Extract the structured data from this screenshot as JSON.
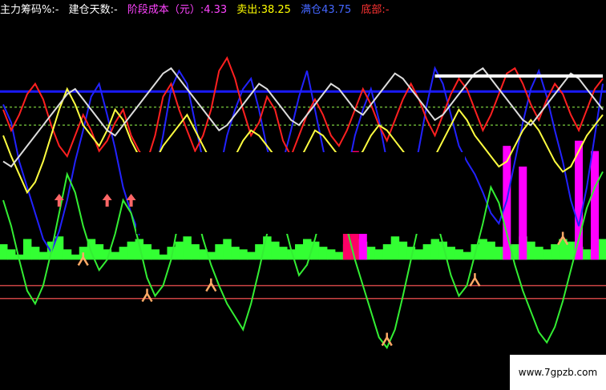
{
  "header": {
    "items": [
      {
        "label": "主力筹码%:",
        "value": "-",
        "color": "#ffffff"
      },
      {
        "label": "建仓天数:",
        "value": "-",
        "color": "#ffffff"
      },
      {
        "label": "阶段成本（元）:",
        "value": "4.33",
        "color": "#ff44ff"
      },
      {
        "label": "卖出:",
        "value": "38.25",
        "color": "#ffff00"
      },
      {
        "label": "满仓",
        "value": "43.75",
        "color": "#4466ff"
      },
      {
        "label": "底部:",
        "value": "-",
        "color": "#ff3333"
      }
    ]
  },
  "watermark": "www.7gpzb.com",
  "colors": {
    "background": "#000000",
    "bar_green": "#33ff33",
    "bar_magenta": "#ff00ff",
    "bar_red": "#ff0066",
    "line_blue": "#2222ff",
    "line_red": "#ff2020",
    "line_yellow": "#ffff40",
    "line_white": "#dddddd",
    "line_green": "#33ee33",
    "hline_blue": "#1a1aff",
    "hline_green": "#66aa33",
    "hline_red": "#cc4444",
    "marker_orange": "#ffaa66",
    "arrow_red": "#ff6666"
  },
  "chart_data": {
    "type": "line",
    "title": "",
    "xlabel": "",
    "ylabel": "",
    "ylim": [
      -20,
      110
    ],
    "grid": false,
    "x": [
      0,
      1,
      2,
      3,
      4,
      5,
      6,
      7,
      8,
      9,
      10,
      11,
      12,
      13,
      14,
      15,
      16,
      17,
      18,
      19,
      20,
      21,
      22,
      23,
      24,
      25,
      26,
      27,
      28,
      29,
      30,
      31,
      32,
      33,
      34,
      35,
      36,
      37,
      38,
      39,
      40,
      41,
      42,
      43,
      44,
      45,
      46,
      47,
      48,
      49,
      50,
      51,
      52,
      53,
      54,
      55,
      56,
      57,
      58,
      59,
      60,
      61,
      62,
      63,
      64,
      65,
      66,
      67,
      68,
      69,
      70,
      71,
      72,
      73,
      74,
      75
    ],
    "reference_lines": [
      {
        "name": "",
        "value": 87,
        "color": "hline_blue"
      },
      {
        "name": "",
        "value": 81,
        "color": "hline_green"
      },
      {
        "name": "",
        "value": 74,
        "color": "hline_green"
      },
      {
        "name": "",
        "value": 12,
        "color": "hline_red"
      },
      {
        "name": "",
        "value": 7,
        "color": "hline_red"
      }
    ],
    "series": [
      {
        "color": "line_blue",
        "values": [
          82,
          75,
          60,
          50,
          40,
          30,
          25,
          33,
          45,
          60,
          72,
          85,
          90,
          78,
          65,
          50,
          40,
          32,
          40,
          55,
          70,
          88,
          95,
          90,
          75,
          60,
          48,
          55,
          70,
          80,
          88,
          92,
          80,
          65,
          55,
          60,
          72,
          85,
          95,
          80,
          65,
          50,
          45,
          55,
          70,
          80,
          88,
          76,
          60,
          45,
          38,
          50,
          65,
          82,
          96,
          90,
          78,
          66,
          60,
          55,
          48,
          40,
          36,
          45,
          60,
          75,
          88,
          95,
          85,
          72,
          60,
          45,
          35,
          50,
          70,
          90
        ]
      },
      {
        "color": "line_red",
        "values": [
          80,
          72,
          78,
          86,
          90,
          84,
          74,
          66,
          62,
          70,
          78,
          72,
          64,
          68,
          75,
          80,
          70,
          64,
          60,
          70,
          85,
          90,
          80,
          72,
          64,
          70,
          80,
          95,
          100,
          92,
          80,
          70,
          75,
          85,
          80,
          68,
          62,
          70,
          78,
          84,
          78,
          70,
          66,
          72,
          80,
          88,
          82,
          74,
          68,
          76,
          84,
          90,
          84,
          76,
          70,
          78,
          86,
          92,
          88,
          80,
          72,
          78,
          86,
          94,
          96,
          90,
          82,
          76,
          84,
          90,
          86,
          78,
          72,
          80,
          88,
          92
        ]
      },
      {
        "color": "line_yellow",
        "values": [
          70,
          62,
          55,
          48,
          52,
          60,
          70,
          80,
          88,
          82,
          74,
          70,
          66,
          72,
          80,
          76,
          68,
          62,
          58,
          60,
          66,
          70,
          74,
          78,
          72,
          66,
          60,
          56,
          58,
          62,
          68,
          72,
          70,
          66,
          62,
          58,
          56,
          60,
          66,
          72,
          70,
          66,
          62,
          58,
          60,
          64,
          70,
          74,
          72,
          68,
          64,
          60,
          56,
          58,
          62,
          68,
          74,
          80,
          76,
          70,
          66,
          62,
          58,
          60,
          66,
          72,
          76,
          72,
          66,
          60,
          56,
          58,
          64,
          70,
          74,
          78
        ]
      },
      {
        "color": "line_white",
        "values": [
          60,
          58,
          62,
          66,
          70,
          74,
          78,
          82,
          86,
          88,
          84,
          80,
          76,
          72,
          70,
          74,
          78,
          82,
          86,
          90,
          94,
          96,
          92,
          88,
          84,
          80,
          76,
          72,
          74,
          78,
          82,
          86,
          90,
          88,
          84,
          80,
          76,
          74,
          78,
          82,
          86,
          90,
          88,
          84,
          80,
          78,
          82,
          86,
          90,
          94,
          92,
          88,
          84,
          80,
          76,
          78,
          82,
          86,
          90,
          94,
          96,
          92,
          88,
          84,
          80,
          76,
          74,
          78,
          82,
          86,
          90,
          94,
          92,
          88,
          84,
          80
        ]
      },
      {
        "color": "line_green",
        "values": [
          45,
          35,
          22,
          10,
          5,
          12,
          25,
          40,
          55,
          48,
          35,
          25,
          18,
          22,
          32,
          45,
          40,
          28,
          15,
          8,
          12,
          22,
          38,
          50,
          42,
          30,
          20,
          12,
          5,
          0,
          -5,
          5,
          18,
          32,
          44,
          38,
          26,
          16,
          20,
          30,
          42,
          52,
          46,
          34,
          22,
          12,
          2,
          -8,
          -12,
          -5,
          8,
          22,
          36,
          48,
          40,
          28,
          16,
          8,
          12,
          24,
          36,
          50,
          44,
          32,
          20,
          10,
          2,
          -6,
          -10,
          -4,
          6,
          18,
          30,
          42,
          50,
          56
        ]
      },
      {
        "color": "marker_orange",
        "values": [
          null,
          null,
          null,
          null,
          null,
          null,
          null,
          null,
          null,
          null,
          22,
          null,
          null,
          null,
          null,
          null,
          null,
          null,
          8,
          null,
          null,
          null,
          null,
          null,
          null,
          null,
          12,
          null,
          null,
          null,
          null,
          null,
          null,
          null,
          null,
          null,
          null,
          null,
          null,
          null,
          null,
          null,
          null,
          null,
          null,
          null,
          null,
          null,
          -9,
          null,
          null,
          null,
          null,
          null,
          null,
          null,
          null,
          null,
          null,
          14,
          null,
          null,
          null,
          null,
          null,
          null,
          null,
          null,
          null,
          null,
          30,
          null,
          null,
          null,
          null,
          null
        ]
      }
    ],
    "volume_bars": {
      "baseline": 22,
      "values": [
        28,
        26,
        24,
        30,
        27,
        25,
        29,
        31,
        26,
        24,
        27,
        30,
        28,
        26,
        25,
        27,
        29,
        30,
        28,
        26,
        24,
        27,
        29,
        31,
        28,
        26,
        25,
        28,
        30,
        27,
        26,
        25,
        28,
        31,
        29,
        27,
        26,
        28,
        30,
        29,
        27,
        26,
        25,
        28,
        30,
        29,
        27,
        26,
        28,
        31,
        29,
        27,
        26,
        28,
        30,
        29,
        27,
        26,
        25,
        28,
        30,
        29,
        27,
        26,
        28,
        31,
        29,
        27,
        26,
        28,
        30,
        29,
        27,
        26,
        28,
        30
      ]
    },
    "highlight_bars": [
      {
        "x": 43,
        "height": 40,
        "color": "bar_red"
      },
      {
        "x": 44,
        "height": 42,
        "color": "bar_red"
      },
      {
        "x": 45,
        "height": 38,
        "color": "bar_magenta"
      },
      {
        "x": 63,
        "height": 44,
        "color": "bar_magenta"
      },
      {
        "x": 65,
        "height": 36,
        "color": "bar_magenta"
      },
      {
        "x": 72,
        "height": 46,
        "color": "bar_magenta"
      },
      {
        "x": 74,
        "height": 42,
        "color": "bar_magenta"
      }
    ],
    "arrows_up": [
      7,
      13,
      16
    ],
    "white_bar": {
      "x_start": 54,
      "x_end": 75,
      "value": 93
    }
  }
}
